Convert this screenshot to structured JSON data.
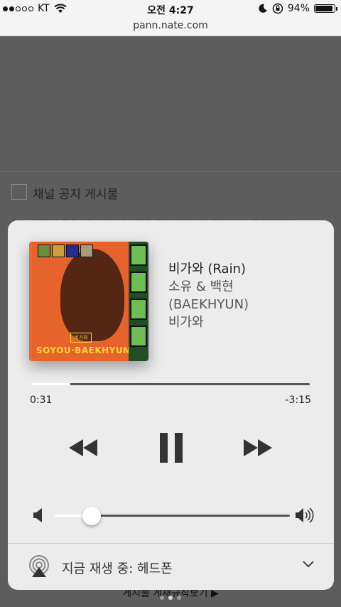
{
  "status_bar": {
    "carrier": "KT",
    "time": "오전 4:27",
    "battery_percent": "94%",
    "battery_level": 0.94,
    "signal_dots": [
      true,
      true,
      false,
      false,
      false
    ],
    "icons": [
      "wifi-icon",
      "moon-icon",
      "rotation-lock-icon",
      "battery-icon"
    ]
  },
  "browser": {
    "url": "pann.nate.com"
  },
  "background_page": {
    "checkbox_label": "채널 공지 게시물",
    "partial_text": "팬들과 공유하고 싶은 게시물을 공지 추천수에 따라 채널 공지영역에",
    "bottom_link": "게시물 게재규칙보기 ▶"
  },
  "now_playing": {
    "title": "비가와 (Rain)",
    "artist_line1": "소유 & 백현",
    "artist_line2": "(BAEKHYUN)",
    "album": "비가와",
    "album_art": {
      "label": "비가와",
      "artist_text": "SOYOU·BAEKHYUN"
    },
    "elapsed": "0:31",
    "remaining": "-3:15",
    "progress": 0.14,
    "volume": 0.16
  },
  "audio_route": {
    "label": "지금 재생 중: 헤드폰"
  },
  "page_indicator": {
    "count": 3,
    "active": 1
  },
  "colors": {
    "card_bg": "#ececec",
    "dim_bg": "#5e5e5e",
    "accent_text": "#222222"
  }
}
